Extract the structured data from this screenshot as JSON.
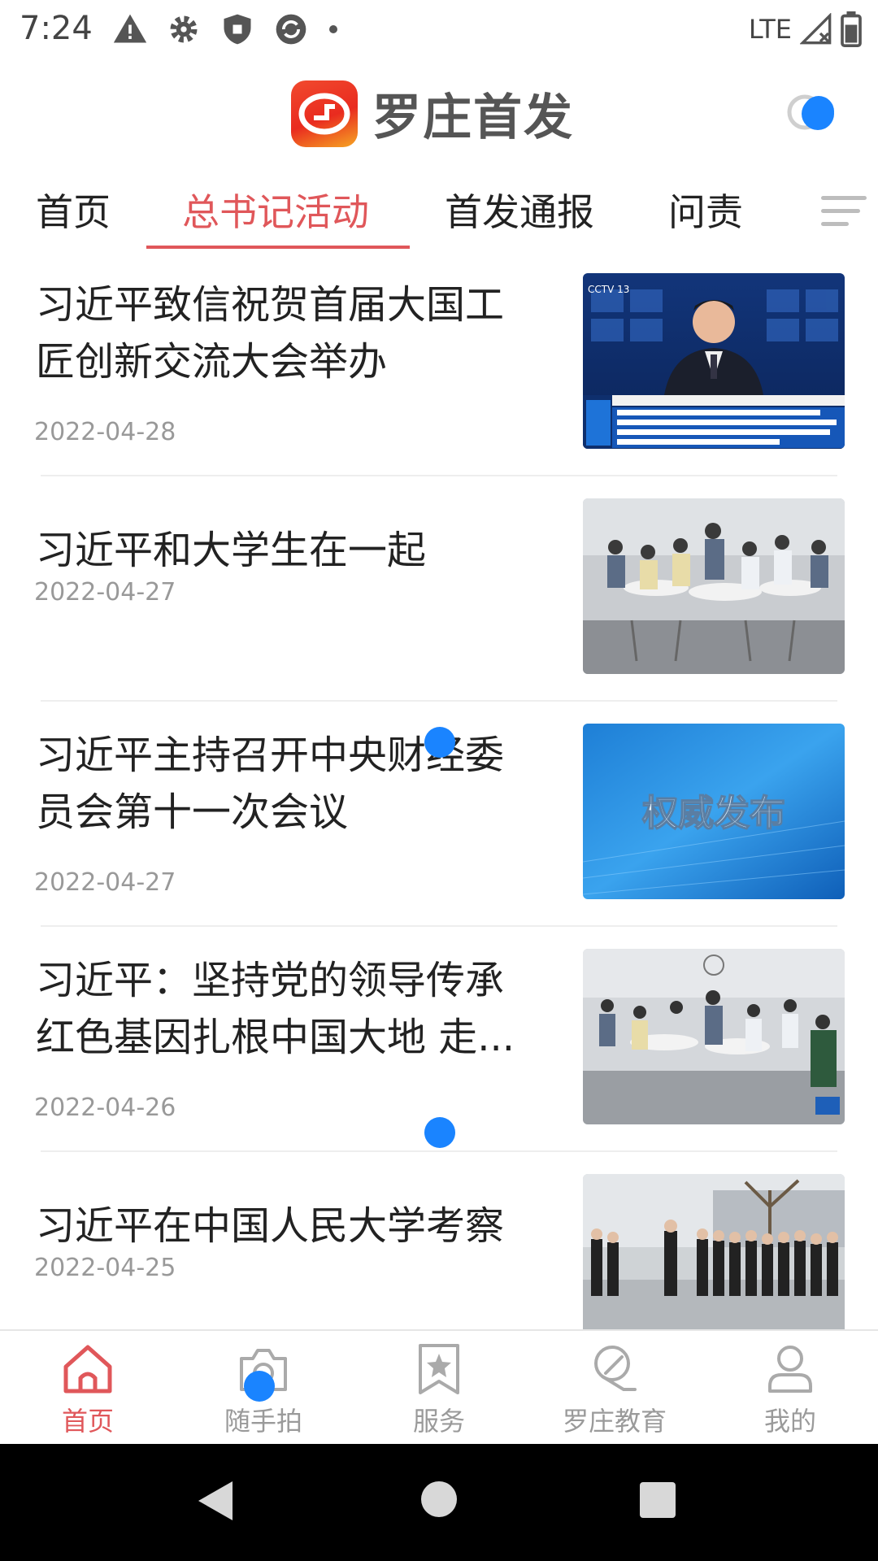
{
  "status_bar": {
    "time": "7:24",
    "network": "LTE",
    "icons": [
      "warning-icon",
      "gear-icon",
      "shield-icon",
      "sync-icon",
      "dot-icon",
      "signal-icon",
      "battery-icon"
    ]
  },
  "header": {
    "app_name": "罗庄首发",
    "accent_color": "#e0575a"
  },
  "tabs": [
    {
      "label": "首页",
      "active": false
    },
    {
      "label": "总书记活动",
      "active": true
    },
    {
      "label": "首发通报",
      "active": false
    },
    {
      "label": "问责",
      "active": false
    }
  ],
  "news": [
    {
      "title": "习近平致信祝贺首届大国工匠创新交流大会举办",
      "date": "2022-04-28",
      "thumb": "news-anchor-broadcast"
    },
    {
      "title": "习近平和大学生在一起",
      "date": "2022-04-27",
      "thumb": "classroom-meeting"
    },
    {
      "title": "习近平主持召开中央财经委员会第十一次会议",
      "date": "2022-04-27",
      "thumb": "authority-release",
      "thumb_text": "权威发布"
    },
    {
      "title": "习近平：坚持党的领导传承红色基因扎根中国大地 走...",
      "date": "2022-04-26",
      "thumb": "classroom-meeting-2"
    },
    {
      "title": "习近平在中国人民大学考察",
      "date": "2022-04-25",
      "thumb": "campus-visit"
    }
  ],
  "bottom_nav": [
    {
      "label": "首页",
      "icon": "home-icon",
      "active": true
    },
    {
      "label": "随手拍",
      "icon": "camera-icon",
      "active": false
    },
    {
      "label": "服务",
      "icon": "bookmark-star-icon",
      "active": false
    },
    {
      "label": "罗庄教育",
      "icon": "education-icon",
      "active": false
    },
    {
      "label": "我的",
      "icon": "profile-icon",
      "active": false
    }
  ]
}
